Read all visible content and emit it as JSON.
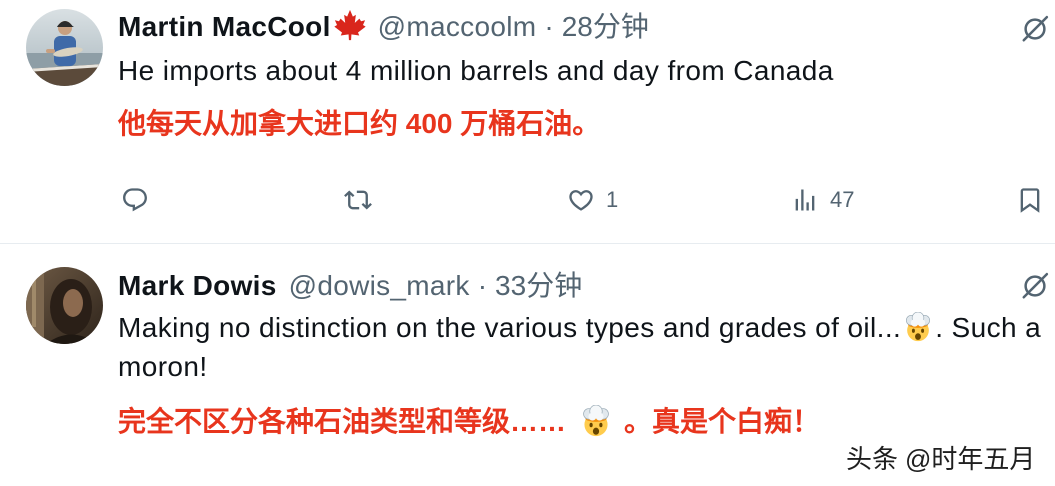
{
  "colors": {
    "text": "#0f1419",
    "secondary": "#536471",
    "translation": "#e8351d",
    "divider": "#e7ecf0",
    "watermark": "#1f1f1f",
    "maple_leaf": "#d9261c"
  },
  "tweets": [
    {
      "avatar_icon": "user-avatar-photo",
      "author": {
        "name": "Martin MacCool",
        "name_emoji": "maple-leaf-icon",
        "handle": "@maccoolm",
        "separator": "·",
        "time": "28分钟"
      },
      "menu_icon": "grok-icon",
      "text": "He imports about 4 million barrels and day from Canada",
      "translation": "他每天从加拿大进口约 400 万桶石油。",
      "actions": {
        "reply": {
          "icon": "reply-icon"
        },
        "repost": {
          "icon": "repost-icon"
        },
        "like": {
          "icon": "heart-icon",
          "count": "1"
        },
        "views": {
          "icon": "views-icon",
          "count": "47"
        },
        "bookmark": {
          "icon": "bookmark-icon"
        }
      }
    },
    {
      "avatar_icon": "user-avatar-photo",
      "author": {
        "name": "Mark Dowis",
        "handle": "@dowis_mark",
        "separator": "·",
        "time": "33分钟"
      },
      "menu_icon": "grok-icon",
      "text": {
        "before_emoji": "Making no distinction on the various types and grades of oil...",
        "emoji": "exploding-head-icon",
        "after_emoji": ". Such a moron!"
      },
      "translation": {
        "before_emoji": "完全不区分各种石油类型和等级……",
        "emoji": "exploding-head-icon",
        "after_emoji": "。真是个白痴！"
      }
    }
  ],
  "watermark": {
    "source": "头条",
    "account": "@时年五月"
  }
}
